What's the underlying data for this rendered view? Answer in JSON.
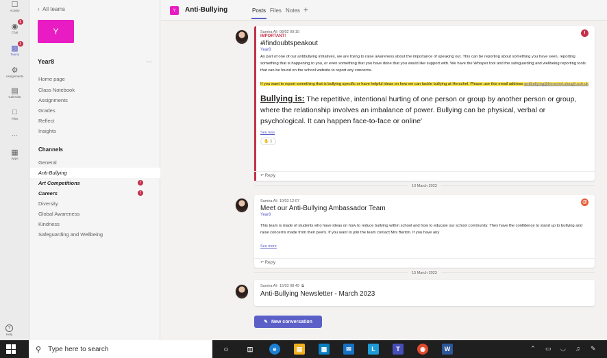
{
  "rail": [
    {
      "name": "activity",
      "label": "Activity",
      "icon": "bell-icon",
      "top": 0
    },
    {
      "name": "chat",
      "label": "Chat",
      "icon": "chat-icon",
      "badge": "1"
    },
    {
      "name": "teams",
      "label": "Teams",
      "icon": "teams-icon",
      "badge": "1"
    },
    {
      "name": "assignments",
      "label": "Assignments",
      "icon": "assignments-icon"
    },
    {
      "name": "calendar",
      "label": "Calendar",
      "icon": "calendar-icon"
    },
    {
      "name": "files",
      "label": "Files",
      "icon": "file-icon"
    },
    {
      "name": "more",
      "label": "...",
      "icon": "more-icon"
    },
    {
      "name": "apps",
      "label": "Apps",
      "icon": "apps-icon"
    }
  ],
  "help_label": "Help",
  "team": {
    "back_label": "All teams",
    "avatar_letter": "Y",
    "name": "Year8",
    "more": "...",
    "nav": [
      "Home page",
      "Class Notebook",
      "Assignments",
      "Grades",
      "Reflect",
      "Insights"
    ],
    "channels_header": "Channels",
    "channels": [
      {
        "label": "General"
      },
      {
        "label": "Anti-Bullying",
        "active": true
      },
      {
        "label": "Art Competitions",
        "bold": true,
        "alert": "!"
      },
      {
        "label": "Careers",
        "bold": true,
        "alert": "!"
      },
      {
        "label": "Diversity"
      },
      {
        "label": "Global Awareness"
      },
      {
        "label": "Kindness"
      },
      {
        "label": "Safeguarding and Wellbeing"
      }
    ]
  },
  "header": {
    "avatar_letter": "Y",
    "title": "Anti-Bullying",
    "tabs": [
      "Posts",
      "Files",
      "Notes"
    ],
    "add_tab": "+"
  },
  "posts": [
    {
      "author": "Samira Ali",
      "time": "08/02 09:10",
      "important": "IMPORTANT!",
      "subject": "#ifindoubtspeakout",
      "channel": "Year8",
      "para1": "As part of one of our antibullying initiatives, we are trying to raise awareness about the importance of speaking out. This can be reporting about something you have seen, reporting something that is happening to you, or even something that you have done that you would like support with. We have the Whisper tool and the safeguarding and wellbeing reporting tools that can be found on the school website to report any concerns.",
      "highlight": "If you want to report something that is bullying specific or have helpful ideas on how we can tackle bullying at Herschel. Please use this email address ",
      "email": "antibullying@herschel.slough.sch.uk",
      "big_label": "Bullying is:",
      "big_text": " The repetitive, intentional hurting of one person or group by another person or group, where the relationship involves an imbalance of power. Bullying can be physical, verbal or psychological. It can happen face-to-face or online'",
      "see_less": "See less",
      "reaction": "1",
      "reply": "Reply"
    },
    {
      "author": "Samira Ali",
      "time": "10/03 12:07",
      "subject": "Meet our Anti-Bullying Ambassador Team",
      "channel": "Year8",
      "para1": "This team is made of students who have ideas on how to reduce bullying within school and how to educate our school community. They have the confidence to stand up to bullying and raise concerns made from their peers. If you want to join the team contact Mrs Barton. If you have any",
      "see_more": "See more",
      "reply": "Reply"
    },
    {
      "author": "Samira Ali",
      "time": "15/03 08:49",
      "subject": "Anti-Bullying Newsletter - March 2023"
    }
  ],
  "dates": [
    "10 March 2023",
    "15 March 2023"
  ],
  "new_conversation": "New conversation",
  "taskbar": {
    "search_placeholder": "Type here to search"
  }
}
